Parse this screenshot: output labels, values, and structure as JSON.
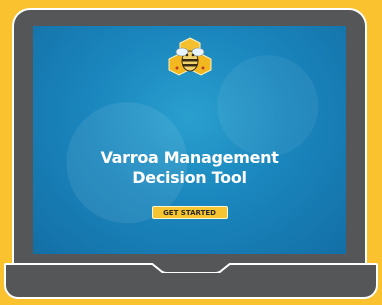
{
  "screen": {
    "title_line1": "Varroa Management",
    "title_line2": "Decision Tool",
    "cta_label": "GET STARTED"
  },
  "colors": {
    "background": "#FBC230",
    "laptop_body": "#555657",
    "screen_blue": "#1a86bd",
    "button_yellow": "#F7C531"
  },
  "icons": {
    "logo": "bee-logo-icon"
  }
}
